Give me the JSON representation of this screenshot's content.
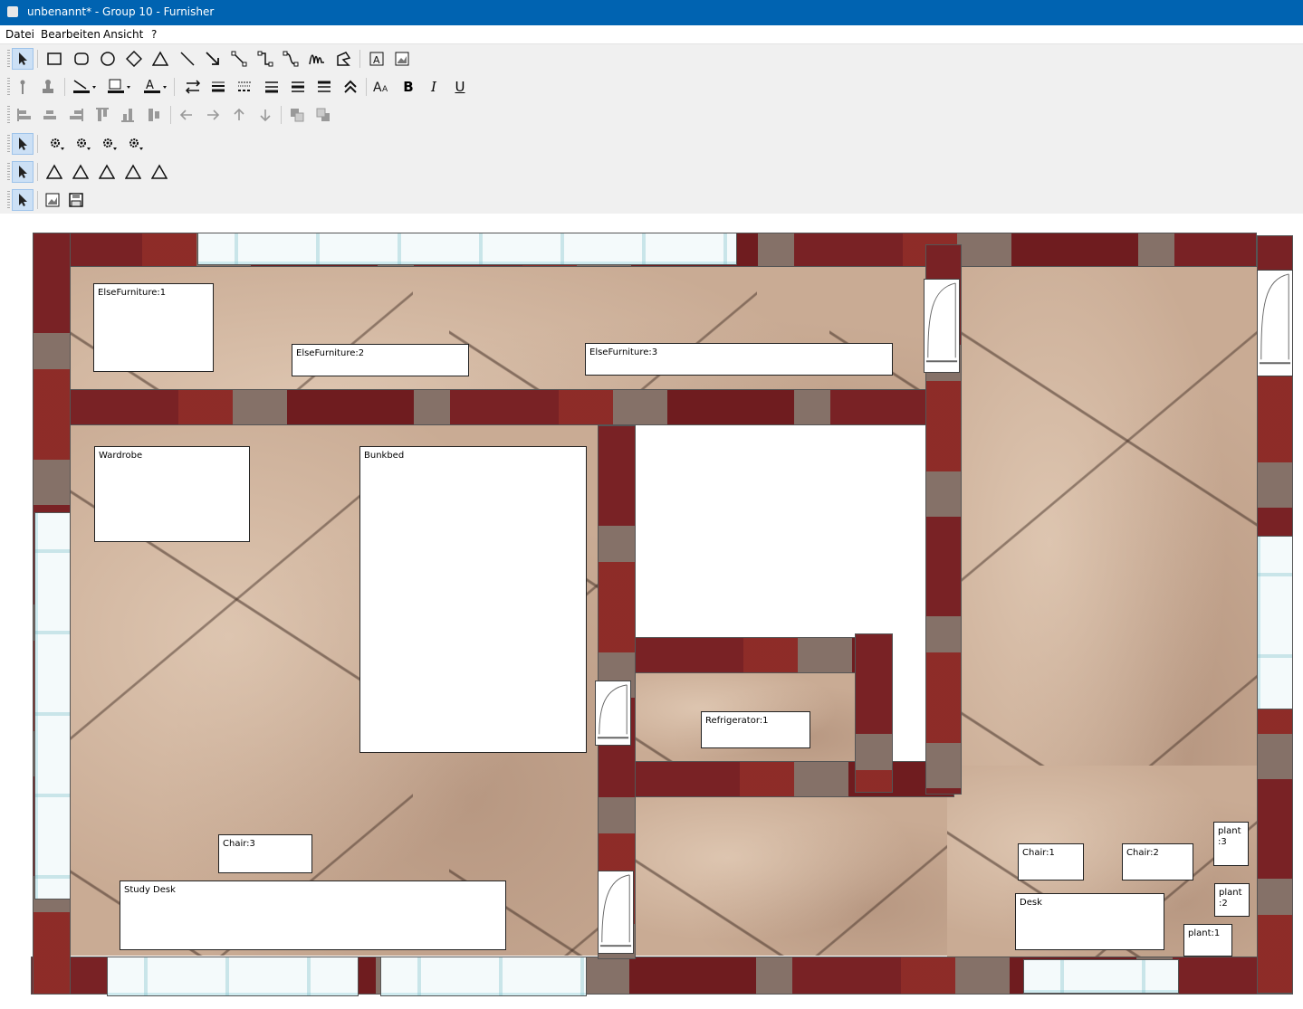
{
  "window": {
    "title": "unbenannt* - Group 10 - Furnisher"
  },
  "menu": {
    "items": [
      "Datei",
      "Bearbeiten",
      "Ansicht",
      "?"
    ]
  },
  "toolbar": {
    "row1_icons": [
      "pointer-icon",
      "rectangle-icon",
      "rounded-rectangle-icon",
      "ellipse-icon",
      "diamond-icon",
      "triangle-icon",
      "line-icon",
      "arrow-icon",
      "connector-icon",
      "elbow-connector-icon",
      "curved-connector-icon",
      "freehand-icon",
      "polygon-icon",
      "text-icon",
      "image-icon"
    ],
    "row2_icons": [
      "pin-icon",
      "stamp-icon",
      "line-color-icon",
      "fill-color-icon",
      "font-color-icon",
      "spacing-icon",
      "line-width-icon",
      "line-dash-icon",
      "align-top-icon",
      "align-middle-icon",
      "align-bottom-icon",
      "collapse-icon",
      "font-size-icon",
      "bold-icon",
      "italic-icon",
      "underline-icon"
    ],
    "row3_icons": [
      "align-left-icon",
      "align-center-icon",
      "align-right-icon",
      "align-top-edge-icon",
      "align-bottom-edge-icon",
      "align-middle-edge-icon",
      "arrow-left-icon",
      "arrow-right-icon",
      "arrow-up-icon",
      "arrow-down-icon",
      "bring-front-icon",
      "send-back-icon"
    ],
    "row4_icons": [
      "pointer-icon",
      "gear-icon",
      "gear-icon",
      "gear-icon",
      "gear-icon"
    ],
    "row5_icons": [
      "pointer-icon",
      "triangle-icon",
      "triangle-icon",
      "triangle-icon",
      "triangle-icon",
      "triangle-icon"
    ],
    "row6_icons": [
      "pointer-icon",
      "image-icon",
      "save-icon"
    ],
    "bold_label": "B",
    "italic_label": "I",
    "underline_label": "U",
    "font_color_label": "A"
  },
  "furniture": [
    {
      "label": "ElseFurniture:1"
    },
    {
      "label": "ElseFurniture:2"
    },
    {
      "label": "ElseFurniture:3"
    },
    {
      "label": "Wardrobe"
    },
    {
      "label": "Bunkbed"
    },
    {
      "label": "Refrigerator:1"
    },
    {
      "label": "Chair:3"
    },
    {
      "label": "Study Desk"
    },
    {
      "label": "Chair:1"
    },
    {
      "label": "Chair:2"
    },
    {
      "label": "plant\n:3"
    },
    {
      "label": "plant\n:2"
    },
    {
      "label": "Desk"
    },
    {
      "label": "plant:1"
    }
  ],
  "colors": {
    "titlebar": "#0063b1",
    "wall": "#a8333a",
    "toolbar_bg": "#f0f0f0",
    "selected_tool": "#cce0f5"
  }
}
